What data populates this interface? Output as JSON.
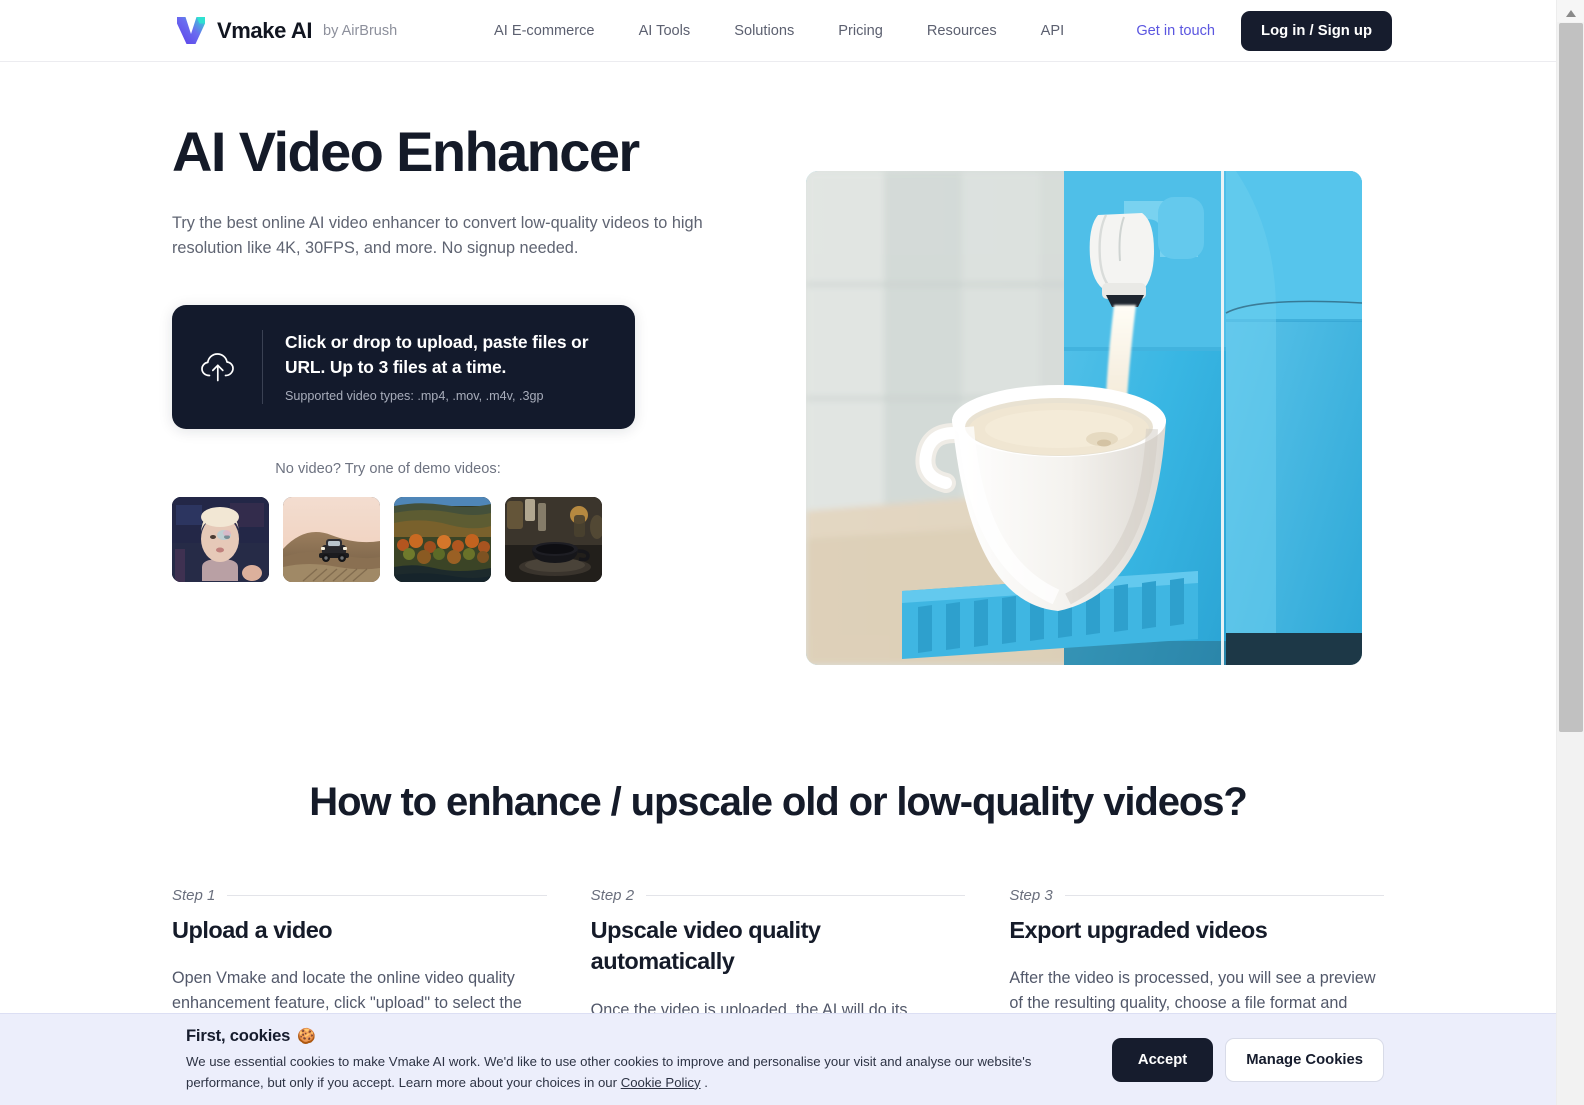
{
  "header": {
    "brand_name": "Vmake AI",
    "brand_by": "by AirBrush",
    "nav": [
      {
        "label": "AI E-commerce"
      },
      {
        "label": "AI Tools"
      },
      {
        "label": "Solutions"
      },
      {
        "label": "Pricing"
      },
      {
        "label": "Resources"
      },
      {
        "label": "API"
      }
    ],
    "get_in_touch": "Get in touch",
    "login_signup": "Log in / Sign up"
  },
  "hero": {
    "title": "AI Video Enhancer",
    "subtitle": "Try the best online AI video enhancer to convert low-quality videos to high resolution like 4K, 30FPS, and more. No signup needed.",
    "upload": {
      "main": "Click or drop to upload, paste files or URL. Up to 3 files at a time.",
      "types": "Supported video types: .mp4, .mov, .m4v, .3gp"
    },
    "demo_label": "No video? Try one of demo videos:",
    "demos": [
      {
        "name": "demo-portrait-woman"
      },
      {
        "name": "demo-car-desert"
      },
      {
        "name": "demo-autumn-landscape"
      },
      {
        "name": "demo-coffee-cup"
      }
    ],
    "preview_caption": ""
  },
  "howto": {
    "title": "How to enhance / upscale old or low-quality videos?",
    "steps": [
      {
        "num": "Step 1",
        "title": "Upload a video",
        "body": "Open Vmake and locate the online video quality enhancement feature, click \"upload\" to select the video file you want to enhance from your"
      },
      {
        "num": "Step 2",
        "title": "Upscale video quality automatically",
        "body": "Once the video is uploaded, the AI will do its"
      },
      {
        "num": "Step 3",
        "title": "Export upgraded videos",
        "body": "After the video is processed, you will see a preview of the resulting quality, choose a file format and video length to save and export."
      }
    ]
  },
  "cookies": {
    "title": "First, cookies",
    "emoji": "🍪",
    "body_before_link": "We use essential cookies to make Vmake AI work. We'd like to use other cookies to improve and personalise your visit and analyse our website's performance, but only if you accept. Learn more about your choices in our ",
    "link": "Cookie Policy",
    "body_after_link": " .",
    "accept": "Accept",
    "manage": "Manage Cookies"
  },
  "colors": {
    "accent_purple": "#5b56e0",
    "dark": "#161c2d",
    "cookie_bg": "#eceefb",
    "muted_text": "#5f6472"
  }
}
